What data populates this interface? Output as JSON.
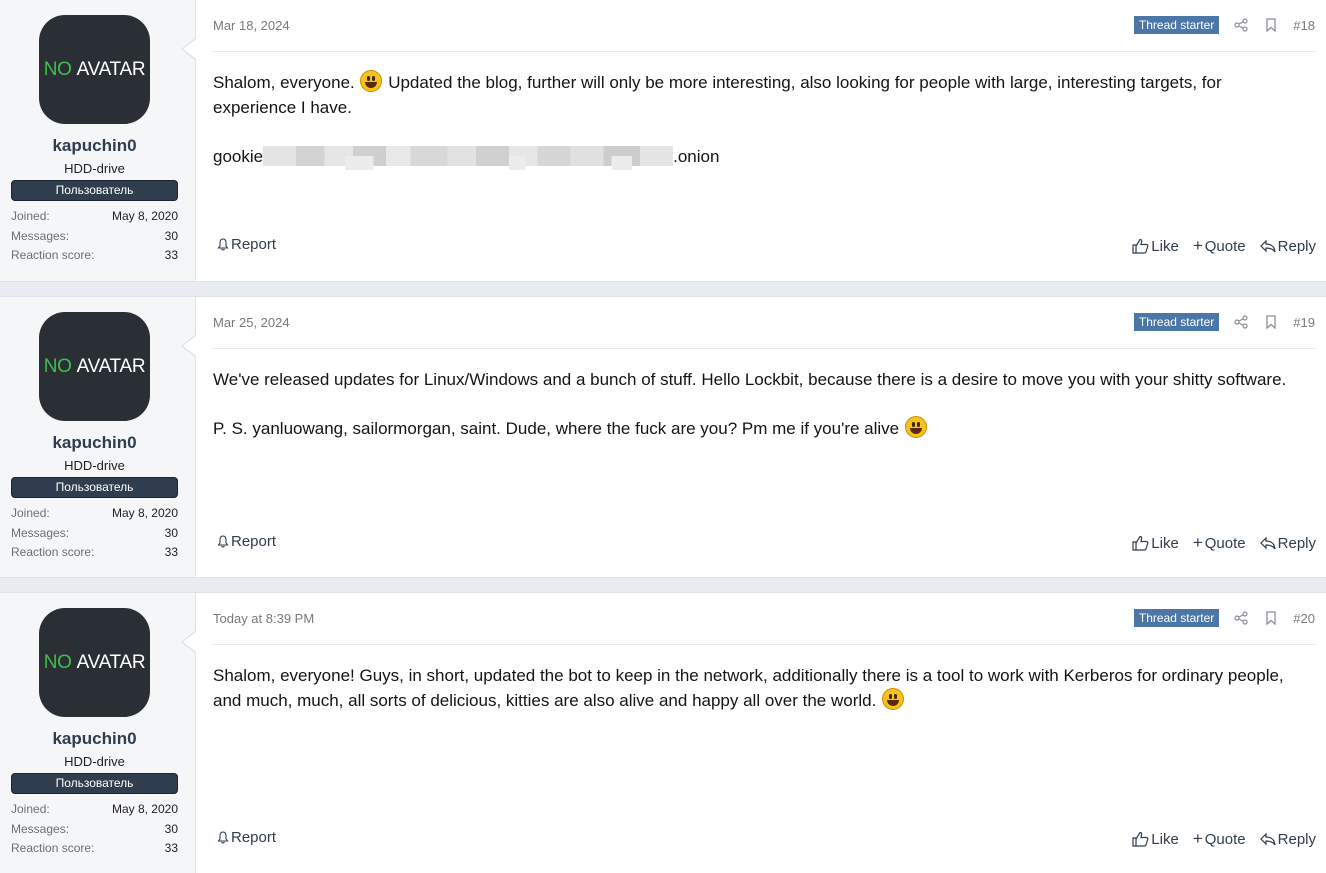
{
  "posts": [
    {
      "user": {
        "avatar_prefix": "NO",
        "avatar_text": "AVATAR",
        "name": "kapuchin0",
        "title": "HDD-drive",
        "banner": "Пользователь",
        "joined_label": "Joined:",
        "joined": "May 8, 2020",
        "messages_label": "Messages:",
        "messages": "30",
        "reaction_label": "Reaction score:",
        "reaction": "33"
      },
      "date": "Mar 18, 2024",
      "badge": "Thread starter",
      "number": "#18",
      "p1_before": "Shalom, everyone. ",
      "p1_after": " Updated the blog, further will only be more interesting, also looking for people with large, interesting targets, for experience I have.",
      "p2_prefix": "gookie",
      "p2_suffix": ".onion",
      "report": "Report",
      "like": "Like",
      "quote": "Quote",
      "reply": "Reply"
    },
    {
      "user": {
        "avatar_prefix": "NO",
        "avatar_text": "AVATAR",
        "name": "kapuchin0",
        "title": "HDD-drive",
        "banner": "Пользователь",
        "joined_label": "Joined:",
        "joined": "May 8, 2020",
        "messages_label": "Messages:",
        "messages": "30",
        "reaction_label": "Reaction score:",
        "reaction": "33"
      },
      "date": "Mar 25, 2024",
      "badge": "Thread starter",
      "number": "#19",
      "p1": "We've released updates for Linux/Windows and a bunch of stuff. Hello Lockbit, because there is a desire to move you with your shitty software.",
      "p2": "P. S. yanluowang, sailormorgan, saint. Dude, where the fuck are you? Pm me if you're alive ",
      "report": "Report",
      "like": "Like",
      "quote": "Quote",
      "reply": "Reply"
    },
    {
      "user": {
        "avatar_prefix": "NO",
        "avatar_text": "AVATAR",
        "name": "kapuchin0",
        "title": "HDD-drive",
        "banner": "Пользователь",
        "joined_label": "Joined:",
        "joined": "May 8, 2020",
        "messages_label": "Messages:",
        "messages": "30",
        "reaction_label": "Reaction score:",
        "reaction": "33"
      },
      "date": "Today at 8:39 PM",
      "badge": "Thread starter",
      "number": "#20",
      "p1": "Shalom, everyone! Guys, in short, updated the bot to keep in the network, additionally there is a tool to work with Kerberos for ordinary people, and much, much, all sorts of delicious, kitties are also alive and happy all over the world. ",
      "report": "Report",
      "like": "Like",
      "quote": "Quote",
      "reply": "Reply"
    }
  ],
  "icons": {
    "share": "share-icon",
    "bookmark": "bookmark-icon",
    "report": "bell-icon",
    "like": "thumbs-up-icon",
    "quote": "plus-icon",
    "reply": "reply-icon",
    "emoji": "grinning-face-emoji"
  },
  "colors": {
    "badge": "#4a76a8",
    "username": "#2f3d4e",
    "banner": "#2f3d4e",
    "avatar_bg": "#2a2f36",
    "avatar_no": "#3fbf4b"
  }
}
